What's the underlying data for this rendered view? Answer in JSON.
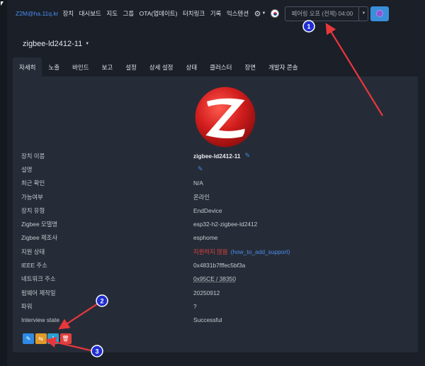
{
  "navbar": {
    "brand": "Z2M@ha.11q.kr",
    "items": [
      "장치",
      "대시보드",
      "지도",
      "그룹",
      "OTA(업데이트)",
      "터치링크",
      "기록",
      "익스텐션"
    ],
    "settings_icon": "gear-icon",
    "language_icon": "korean-flag-icon",
    "pairing_label": "페어링 오프 (전체) 04:00"
  },
  "device": {
    "title": "zigbee-ld2412-11"
  },
  "tabs": [
    "자세히",
    "노출",
    "바인드",
    "보고",
    "설정",
    "상세 설정",
    "상태",
    "클러스터",
    "장면",
    "개발자 콘솔"
  ],
  "details": [
    {
      "key": "장치 이름",
      "value": "zigbee-ld2412-11"
    },
    {
      "key": "설명",
      "value": ""
    },
    {
      "key": "최근 확인",
      "value": "N/A"
    },
    {
      "key": "가능여부",
      "value": "온라인"
    },
    {
      "key": "장치 유형",
      "value": "EndDevice"
    },
    {
      "key": "Zigbee 모델명",
      "value": "esp32-h2-zigbee-ld2412"
    },
    {
      "key": "Zigbee 제조사",
      "value": "esphome"
    },
    {
      "key": "지원 상태",
      "value": "지원하지 않음",
      "link": "(how_to_add_support)"
    },
    {
      "key": "IEEE 주소",
      "value": "0x4831b7fffec5bf3a"
    },
    {
      "key": "네트워크 주소",
      "value": "0x95CE / 38350"
    },
    {
      "key": "펌웨어 제작일",
      "value": "20250912"
    },
    {
      "key": "파워",
      "value": "?"
    },
    {
      "key": "Interview state",
      "value": "Successful"
    }
  ],
  "actions": [
    "edit-icon",
    "swap-icon",
    "info-icon",
    "trash-icon"
  ],
  "annotations": [
    "1",
    "2",
    "3"
  ],
  "colors": {
    "background": "#1a1f28",
    "panel": "#262c37",
    "accent": "#4b8df0",
    "danger": "#e0403e",
    "annotation_arrow": "#e8373b",
    "annotation_badge": "#1f2dd1"
  }
}
